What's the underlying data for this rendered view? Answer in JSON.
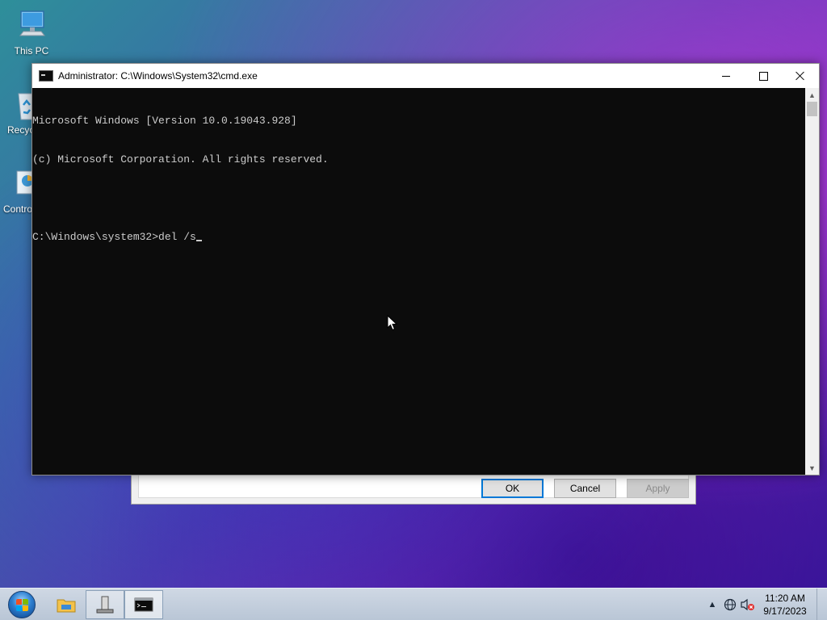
{
  "desktop": {
    "icons": [
      {
        "name": "this-pc",
        "label": "This PC"
      },
      {
        "name": "recycle-bin",
        "label": "Recyc"
      },
      {
        "name": "control-panel",
        "label": "Contro"
      }
    ]
  },
  "background_dialog": {
    "ok_label": "OK",
    "cancel_label": "Cancel",
    "apply_label": "Apply"
  },
  "cmd_window": {
    "title": "Administrator: C:\\Windows\\System32\\cmd.exe",
    "lines": [
      "Microsoft Windows [Version 10.0.19043.928]",
      "(c) Microsoft Corporation. All rights reserved.",
      ""
    ],
    "prompt": "C:\\Windows\\system32>",
    "input": "del /s"
  },
  "taskbar": {
    "start_label": "Start",
    "pinned": [
      "file-explorer",
      "tool",
      "command-prompt"
    ],
    "tray": {
      "time": "11:20 AM",
      "date": "9/17/2023"
    }
  },
  "colors": {
    "console_bg": "#0c0c0c",
    "console_fg": "#cccccc",
    "focus_blue": "#0078d7"
  }
}
